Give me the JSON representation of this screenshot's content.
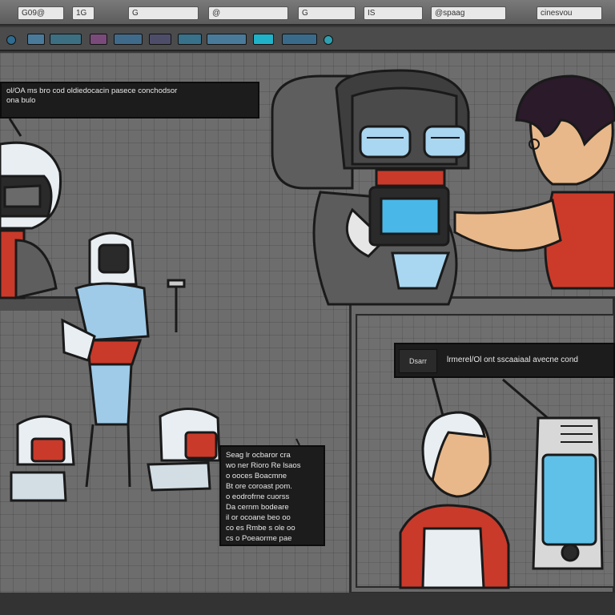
{
  "menubar": {
    "items": [
      {
        "label": "G09@"
      },
      {
        "label": "1G"
      },
      {
        "label": "G"
      },
      {
        "label": "@"
      },
      {
        "label": "G"
      },
      {
        "label": "IS"
      },
      {
        "label": "@spaag"
      },
      {
        "label": "cinesvou"
      }
    ]
  },
  "toolbar": {
    "icons": [
      {
        "name": "select-icon",
        "color": "#2f6c8f"
      },
      {
        "name": "layer-icon",
        "color": "#4a7a9a"
      },
      {
        "name": "frame-icon",
        "color": "#3d6f82"
      },
      {
        "name": "brush-icon",
        "color": "#7a4b7a"
      },
      {
        "name": "shape-icon",
        "color": "#406a8a"
      },
      {
        "name": "text-icon",
        "color": "#4d4d6a"
      },
      {
        "name": "image-icon",
        "color": "#37718a"
      },
      {
        "name": "grid-icon",
        "color": "#4a7a9a"
      },
      {
        "name": "color-icon",
        "color": "#1fb2c8"
      },
      {
        "name": "link-icon",
        "color": "#3a6a8a"
      },
      {
        "name": "settings-icon",
        "color": "#2fa0b0"
      }
    ]
  },
  "captions": {
    "top": {
      "line1": "ol/OA ms bro cod oldiedocacin pasece conchodsor",
      "line2": "ona bulo"
    },
    "right": {
      "tag": "Dsarr",
      "text": "lrmerel/Ol ont sscaaiaal avecne cond"
    },
    "mid": {
      "lines": [
        "Seag lr ocbaror cra",
        "wo ner Rioro Re lsaos",
        "o ooces Boacmne",
        "Bt ore coroast pom.",
        "o eodrofrne cuorss",
        "Da cernm bodeare",
        "il or ocoane beo oo",
        "co es Rmbe s ole oo",
        "cs o Poeaorme pae"
      ]
    }
  },
  "colors": {
    "robot_red": "#c93a2a",
    "robot_white": "#e8eef2",
    "robot_blue": "#9fcbe8",
    "screen_blue": "#3aaee0",
    "skin": "#e8b88a",
    "shirt_red": "#cc3b2a",
    "hair": "#2a1a2a"
  }
}
